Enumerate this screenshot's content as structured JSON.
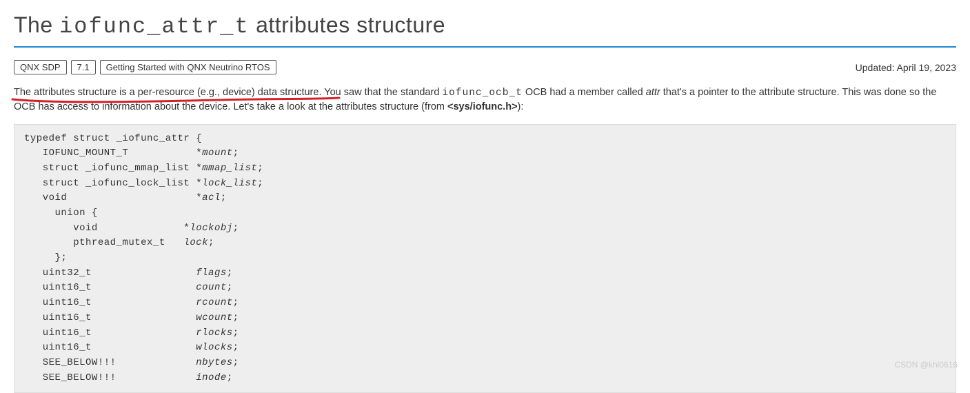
{
  "title": {
    "prefix": "The ",
    "code": "iofunc_attr_t",
    "suffix": " attributes structure"
  },
  "breadcrumbs": {
    "items": [
      "QNX SDP",
      "7.1",
      "Getting Started with QNX Neutrino RTOS"
    ]
  },
  "updated": "Updated: April 19, 2023",
  "intro": {
    "p1a": "The attributes structure is a per-resource (e.g., device) data structure.",
    "p1b": " You saw that the standard ",
    "mono1": "iofunc_ocb_t",
    "p1c": " OCB had a member called ",
    "ital1": "attr",
    "p1d": " that's a pointer to the attribute structure. This was done so the OCB has access to information about the device. Let's take a look at the attributes structure (from ",
    "bold1": "<sys/iofunc.h>",
    "p1e": "):"
  },
  "code": {
    "l01": "typedef struct _iofunc_attr {",
    "l02a": "   IOFUNC_MOUNT_T           *",
    "l02b": "mount",
    "l02c": ";",
    "l03a": "   struct _iofunc_mmap_list *",
    "l03b": "mmap_list",
    "l03c": ";",
    "l04a": "   struct _iofunc_lock_list *",
    "l04b": "lock_list",
    "l04c": ";",
    "l05a": "   void                     *",
    "l05b": "acl",
    "l05c": ";",
    "l06": "     union {",
    "l07a": "        void              *",
    "l07b": "lockobj",
    "l07c": ";",
    "l08a": "        pthread_mutex_t   ",
    "l08b": "lock",
    "l08c": ";",
    "l09": "     };",
    "l10a": "   uint32_t                 ",
    "l10b": "flags",
    "l10c": ";",
    "l11a": "   uint16_t                 ",
    "l11b": "count",
    "l11c": ";",
    "l12a": "   uint16_t                 ",
    "l12b": "rcount",
    "l12c": ";",
    "l13a": "   uint16_t                 ",
    "l13b": "wcount",
    "l13c": ";",
    "l14a": "   uint16_t                 ",
    "l14b": "rlocks",
    "l14c": ";",
    "l15a": "   uint16_t                 ",
    "l15b": "wlocks",
    "l15c": ";",
    "l16a": "   SEE_BELOW!!!             ",
    "l16b": "nbytes",
    "l16c": ";",
    "l17a": "   SEE_BELOW!!!             ",
    "l17b": "inode",
    "l17c": ";"
  },
  "watermark": "CSDN @khl0616"
}
